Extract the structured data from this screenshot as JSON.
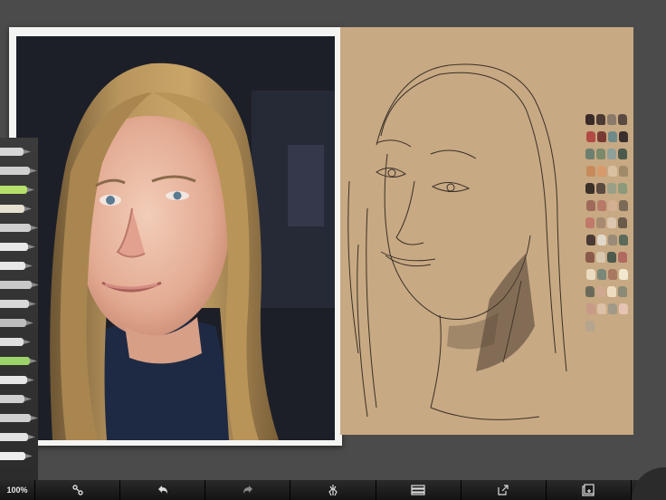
{
  "toolbar": {
    "zoom_label": "100%",
    "buttons": [
      {
        "icon": "brush-properties-icon"
      },
      {
        "icon": "undo-icon"
      },
      {
        "icon": "redo-icon"
      },
      {
        "icon": "symmetry-icon"
      },
      {
        "icon": "layers-icon"
      },
      {
        "icon": "export-icon"
      },
      {
        "icon": "gallery-icon"
      }
    ]
  },
  "tools": [
    "smudge",
    "airbrush",
    "marker",
    "pencil",
    "pencil",
    "pen",
    "pen",
    "brush",
    "brush",
    "paint-roller",
    "paint-tube",
    "color-swatch-tool",
    "eraser",
    "fill",
    "ink-pen",
    "ruler",
    "brush-size-slider"
  ],
  "colors": {
    "background": "#4b4b4b",
    "paper": "#c7a983",
    "photo_frame": "#f4f4f2",
    "toolbar": "#1e1e1e",
    "swatches": [
      "#3a2b28",
      "#4c3a34",
      "#8a7a6a",
      "#5a4a42",
      "#b24a44",
      "#7a3a34",
      "#6f8a88",
      "#3a2f2e",
      "#6d8070",
      "#7a8a6a",
      "#8fa09a",
      "#4b5a4c",
      "#c88a5a",
      "#d89a6a",
      "#d8c0a0",
      "#a08a6a",
      "#3b312a",
      "#5a4a40",
      "#9aa088",
      "#8a9a7a",
      "#a06a5a",
      "#b87a68",
      "#d4b092",
      "#7a6a58",
      "#c07a6a",
      "#a88a70",
      "#dcc6b0",
      "#6a5a4a",
      "#4a3a34",
      "#e0d8c8",
      "#9a8a78",
      "#5a6a5a",
      "#8a5a4a",
      "#d8c8b0",
      "#4e5a4e",
      "#b06a60",
      "#eadcc0",
      "#7a887a",
      "#a87860",
      "#f2e8d0",
      "#6a6a5a",
      "#d0a890",
      "#eedcc0",
      "#8a8a76",
      "#c89a88",
      "#dcc0a8",
      "#a09a88",
      "#e6c4b4",
      "#b6a48e"
    ]
  }
}
